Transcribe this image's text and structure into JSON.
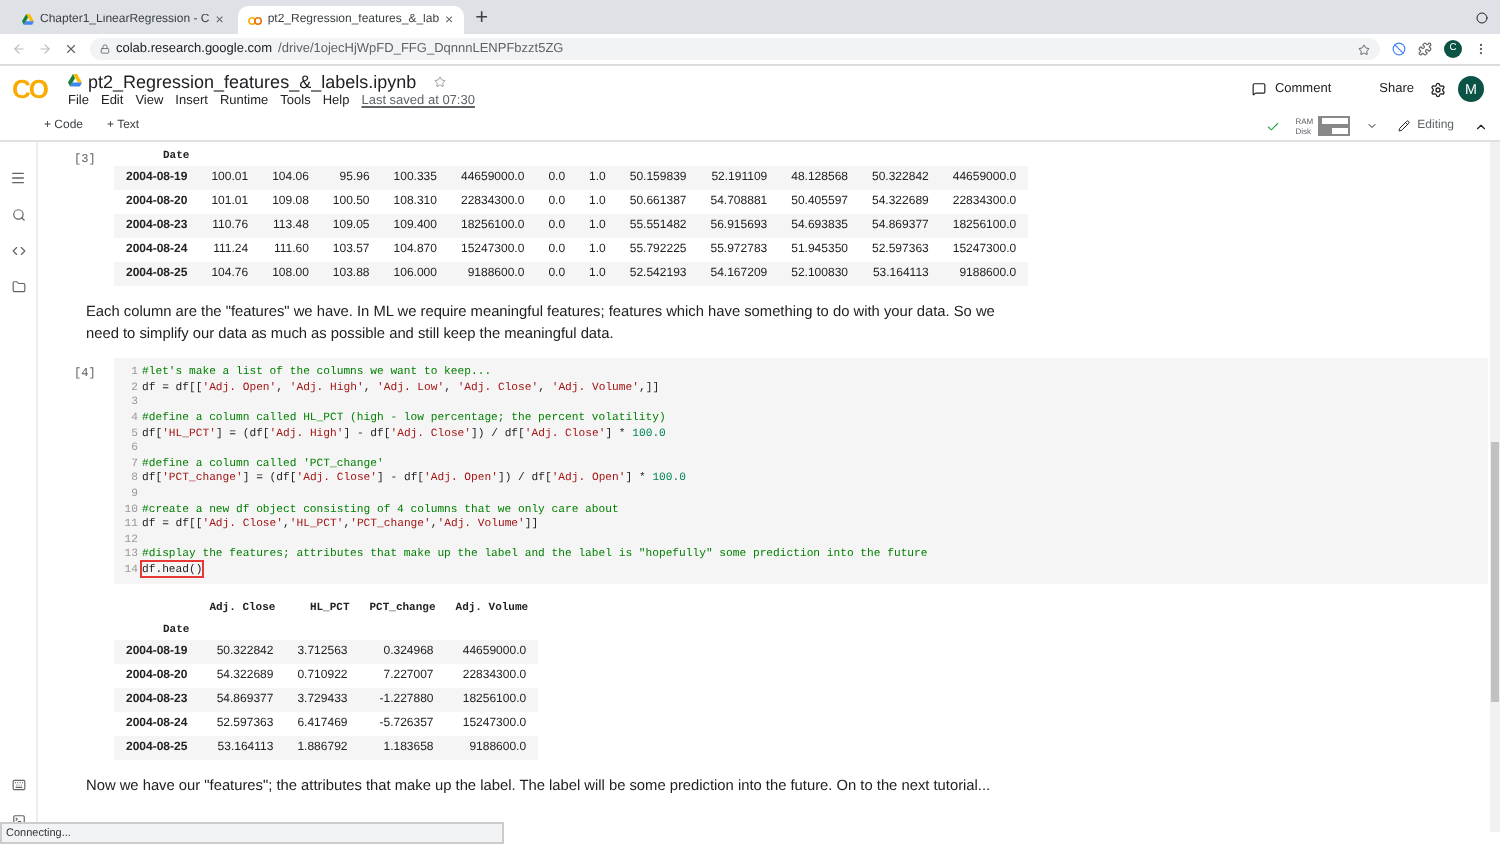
{
  "browser": {
    "tabs": [
      {
        "title": "Chapter1_LinearRegression - C",
        "selected": false,
        "close": "×"
      },
      {
        "title": "pt2_Regression_features_&_lab",
        "selected": true,
        "close": "×"
      }
    ],
    "new_tab": "+",
    "url_host": "colab.research.google.com",
    "url_path": "/drive/1ojecHjWpFD_FFG_DqnnnLENPFbzzt5ZG",
    "profile_initial": "C"
  },
  "colab": {
    "logo": "CO",
    "notebook_title": "pt2_Regression_features_&_labels.ipynb",
    "menu": [
      "File",
      "Edit",
      "View",
      "Insert",
      "Runtime",
      "Tools",
      "Help"
    ],
    "last_saved": "Last saved at 07:30",
    "comment": "Comment",
    "share": "Share",
    "avatar_initial": "M"
  },
  "toolbar": {
    "add_code": "+ Code",
    "add_text": "+ Text",
    "ram": {
      "label": "RAM",
      "level": 0.1
    },
    "disk": {
      "label": "Disk",
      "level": 0.45
    },
    "mode": "Editing"
  },
  "cells": [
    {
      "kind": "output",
      "prompt": "[3]",
      "table": {
        "index_name": "Date",
        "rows": [
          {
            "index": "2004-08-19",
            "values": [
              "100.01",
              "104.06",
              "95.96",
              "100.335",
              "44659000.0",
              "0.0",
              "1.0",
              "50.159839",
              "52.191109",
              "48.128568",
              "50.322842",
              "44659000.0"
            ]
          },
          {
            "index": "2004-08-20",
            "values": [
              "101.01",
              "109.08",
              "100.50",
              "108.310",
              "22834300.0",
              "0.0",
              "1.0",
              "50.661387",
              "54.708881",
              "50.405597",
              "54.322689",
              "22834300.0"
            ]
          },
          {
            "index": "2004-08-23",
            "values": [
              "110.76",
              "113.48",
              "109.05",
              "109.400",
              "18256100.0",
              "0.0",
              "1.0",
              "55.551482",
              "56.915693",
              "54.693835",
              "54.869377",
              "18256100.0"
            ]
          },
          {
            "index": "2004-08-24",
            "values": [
              "111.24",
              "111.60",
              "103.57",
              "104.870",
              "15247300.0",
              "0.0",
              "1.0",
              "55.792225",
              "55.972783",
              "51.945350",
              "52.597363",
              "15247300.0"
            ]
          },
          {
            "index": "2004-08-25",
            "values": [
              "104.76",
              "108.00",
              "103.88",
              "106.000",
              "9188600.0",
              "0.0",
              "1.0",
              "52.542193",
              "54.167209",
              "52.100830",
              "53.164113",
              "9188600.0"
            ]
          }
        ]
      }
    },
    {
      "kind": "text",
      "text": "Each column are the \"features\" we have. In ML we require meaningful features; features which have something to do with your data. So we need to simplify our data as much as possible and still keep the meaningful data."
    },
    {
      "kind": "code",
      "prompt": "[4]",
      "lines": [
        {
          "number": "1",
          "code": "#let's make a list of the columns we want to keep...",
          "boxed": false
        },
        {
          "number": "2",
          "code": "df = df[['Adj. Open', 'Adj. High', 'Adj. Low', 'Adj. Close', 'Adj. Volume',]]",
          "boxed": false
        },
        {
          "number": "3"
        },
        {
          "number": "4",
          "code": "#define a column called HL_PCT (high - low percentage; the percent volatility)",
          "boxed": false
        },
        {
          "number": "5",
          "code": "df['HL_PCT'] = (df['Adj. High'] - df['Adj. Close']) / df['Adj. Close'] * 100.0",
          "boxed": false
        },
        {
          "number": "6"
        },
        {
          "number": "7",
          "code": "#define a column called 'PCT_change'",
          "boxed": false
        },
        {
          "number": "8",
          "code": "df['PCT_change'] = (df['Adj. Close'] - df['Adj. Open']) / df['Adj. Open'] * 100.0",
          "boxed": false
        },
        {
          "number": "9"
        },
        {
          "number": "10",
          "code": "#create a new df object consisting of 4 columns that we only care about",
          "boxed": false
        },
        {
          "number": "11",
          "code": "df = df[['Adj. Close','HL_PCT','PCT_change','Adj. Volume']]",
          "boxed": false
        },
        {
          "number": "12"
        },
        {
          "number": "13",
          "code": "#display the features; attributes that make up the label and the label is \"hopefully\" some prediction into the future",
          "boxed": false
        },
        {
          "number": "14",
          "code": "df.head()",
          "boxed": true
        }
      ],
      "table": {
        "columns": [
          "Adj. Close",
          "HL_PCT",
          "PCT_change",
          "Adj. Volume"
        ],
        "index_name": "Date",
        "rows": [
          {
            "index": "2004-08-19",
            "values": [
              "50.322842",
              "3.712563",
              "0.324968",
              "44659000.0"
            ]
          },
          {
            "index": "2004-08-20",
            "values": [
              "54.322689",
              "0.710922",
              "7.227007",
              "22834300.0"
            ]
          },
          {
            "index": "2004-08-23",
            "values": [
              "54.869377",
              "3.729433",
              "-1.227880",
              "18256100.0"
            ]
          },
          {
            "index": "2004-08-24",
            "values": [
              "52.597363",
              "6.417469",
              "-5.726357",
              "15247300.0"
            ]
          },
          {
            "index": "2004-08-25",
            "values": [
              "53.164113",
              "1.886792",
              "1.183658",
              "9188600.0"
            ]
          }
        ]
      }
    },
    {
      "kind": "text",
      "text": "Now we have our \"features\"; the attributes that make up the label. The label will be some prediction into the future. On to the next tutorial..."
    }
  ],
  "status_bar": "Connecting..."
}
